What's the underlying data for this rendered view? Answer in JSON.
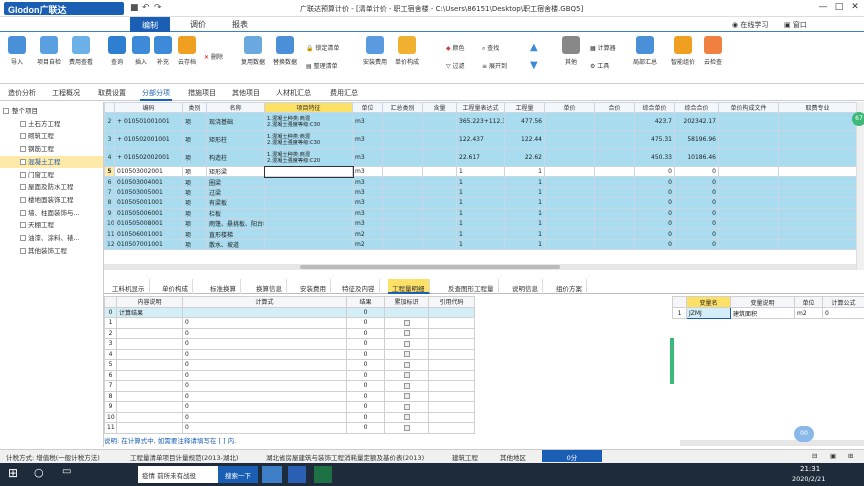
{
  "app": {
    "logo": "Glodon广联达",
    "title": "广联达预算计价 - [清单计价 - 职工宿舍楼 - C:\\Users\\86151\\Desktop\\职工宿舍楼.GBQ5]",
    "learning": "在线学习",
    "window_menu": "窗口"
  },
  "menu": [
    "编制",
    "调价",
    "报表"
  ],
  "ribbon": {
    "buttons": [
      "导入",
      "项目自检",
      "费用查看",
      "查询",
      "插入",
      "补充",
      "云存档",
      "删除",
      "复用数据",
      "替换数据",
      "锁定清单",
      "整理清单",
      "安装费用",
      "单价构成",
      "颜色",
      "过滤",
      "查找",
      "展开到",
      "其他",
      "计算器",
      "工具",
      "局部汇总",
      "智能组价",
      "云检查"
    ]
  },
  "tabs2": [
    "造价分析",
    "工程概况",
    "取费设置",
    "分部分项",
    "措施项目",
    "其他项目",
    "人材机汇总",
    "费用汇总"
  ],
  "tree": {
    "items": [
      "整个项目",
      "土石方工程",
      "砌筑工程",
      "钢筋工程",
      "混凝土工程",
      "门窗工程",
      "屋面及防水工程",
      "楼地面装饰工程",
      "墙、柱面装饰与...",
      "天棚工程",
      "油漆、涂料、裱...",
      "其他装饰工程"
    ]
  },
  "grid": {
    "headers": [
      "编码",
      "类别",
      "名称",
      "项目特征",
      "单位",
      "汇总类别",
      "含量",
      "工程量表达式",
      "工程量",
      "单价",
      "合价",
      "综合单价",
      "综合合价",
      "单价构成文件",
      "取费专业"
    ],
    "rows": [
      {
        "no": "2",
        "code": "010501001001",
        "type": "项",
        "name": "现浇基础",
        "feature": "1.混凝土种类:商混\n2.混凝土强度等级:C30",
        "unit": "m3",
        "expr": "365.223+112.341",
        "qty": "477.56",
        "uprice": "423.7",
        "total": "202342.17"
      },
      {
        "no": "3",
        "code": "010502001001",
        "type": "项",
        "name": "矩形柱",
        "feature": "1.混凝土种类:商混\n2.混凝土强度等级:C30",
        "unit": "m3",
        "expr": "122.437",
        "qty": "122.44",
        "uprice": "475.31",
        "total": "58196.96"
      },
      {
        "no": "4",
        "code": "010502002001",
        "type": "项",
        "name": "构造柱",
        "feature": "1.混凝土种类:商混\n2.混凝土强度等级:C20",
        "unit": "m3",
        "expr": "22.617",
        "qty": "22.62",
        "uprice": "450.33",
        "total": "10186.46"
      },
      {
        "no": "5",
        "code": "010503002001",
        "type": "项",
        "name": "矩形梁",
        "feature": "",
        "unit": "m3",
        "expr": "1",
        "qty": "1",
        "uprice": "0",
        "total": "0"
      },
      {
        "no": "6",
        "code": "010503004001",
        "type": "项",
        "name": "圈梁",
        "feature": "",
        "unit": "m3",
        "expr": "1",
        "qty": "1",
        "uprice": "0",
        "total": "0"
      },
      {
        "no": "7",
        "code": "010503005001",
        "type": "项",
        "name": "过梁",
        "feature": "",
        "unit": "m3",
        "expr": "1",
        "qty": "1",
        "uprice": "0",
        "total": "0"
      },
      {
        "no": "8",
        "code": "010505001001",
        "type": "项",
        "name": "有梁板",
        "feature": "",
        "unit": "m3",
        "expr": "1",
        "qty": "1",
        "uprice": "0",
        "total": "0"
      },
      {
        "no": "9",
        "code": "010505006001",
        "type": "项",
        "name": "栏板",
        "feature": "",
        "unit": "m3",
        "expr": "1",
        "qty": "1",
        "uprice": "0",
        "total": "0"
      },
      {
        "no": "10",
        "code": "010505008001",
        "type": "项",
        "name": "雨篷、悬挑板、阳台板",
        "feature": "",
        "unit": "m3",
        "expr": "1",
        "qty": "1",
        "uprice": "0",
        "total": "0"
      },
      {
        "no": "11",
        "code": "010506001001",
        "type": "项",
        "name": "直形楼梯",
        "feature": "",
        "unit": "m2",
        "expr": "1",
        "qty": "1",
        "uprice": "0",
        "total": "0"
      },
      {
        "no": "12",
        "code": "010507001001",
        "type": "项",
        "name": "散水、坡道",
        "feature": "",
        "unit": "m2",
        "expr": "1",
        "qty": "1",
        "uprice": "0",
        "total": "0"
      }
    ]
  },
  "bottom_tabs": [
    "工料机显示",
    "单价构成",
    "标准换算",
    "换算信息",
    "安装费用",
    "特征及内容",
    "工程量明细",
    "反查图形工程量",
    "说明信息",
    "组价方案"
  ],
  "lower_grid": {
    "headers": [
      "内容说明",
      "计算式",
      "结果",
      "累加标识",
      "引用代码"
    ],
    "rows": [
      {
        "no": "0",
        "desc": "计算结果",
        "formula": "",
        "result": "0"
      },
      {
        "no": "1",
        "desc": "",
        "formula": "0",
        "result": "0"
      },
      {
        "no": "2",
        "desc": "",
        "formula": "0",
        "result": "0"
      },
      {
        "no": "3",
        "desc": "",
        "formula": "0",
        "result": "0"
      },
      {
        "no": "4",
        "desc": "",
        "formula": "0",
        "result": "0"
      },
      {
        "no": "5",
        "desc": "",
        "formula": "0",
        "result": "0"
      },
      {
        "no": "6",
        "desc": "",
        "formula": "0",
        "result": "0"
      },
      {
        "no": "7",
        "desc": "",
        "formula": "0",
        "result": "0"
      },
      {
        "no": "8",
        "desc": "",
        "formula": "0",
        "result": "0"
      },
      {
        "no": "9",
        "desc": "",
        "formula": "0",
        "result": "0"
      },
      {
        "no": "10",
        "desc": "",
        "formula": "0",
        "result": "0"
      },
      {
        "no": "11",
        "desc": "",
        "formula": "0",
        "result": "0"
      }
    ]
  },
  "var_grid": {
    "headers": [
      "变量名",
      "变量说明",
      "单位",
      "计算公式"
    ],
    "row": {
      "no": "1",
      "name": "JZMJ",
      "desc": "建筑面积",
      "unit": "m2",
      "formula": "0"
    }
  },
  "note": "说明: 在计算式中, 如需要注释请填写在 [ ] 内.",
  "status": [
    "计税方式: 增值税(一般计税方法)",
    "工程量清单项目计量规范(2013-湖北)",
    "湖北省房屋建筑与装饰工程消耗量定额及基价表(2013)",
    "建筑工程",
    "其他地区",
    "0分"
  ],
  "taskbar": {
    "search": "疫情 前所未有战役",
    "search_btn": "搜索一下",
    "time": "21:31",
    "date": "2020/2/21"
  },
  "colors": {
    "brand": "#1a5fb4",
    "highlight": "#a9dcef",
    "header_yellow": "#fde066"
  }
}
